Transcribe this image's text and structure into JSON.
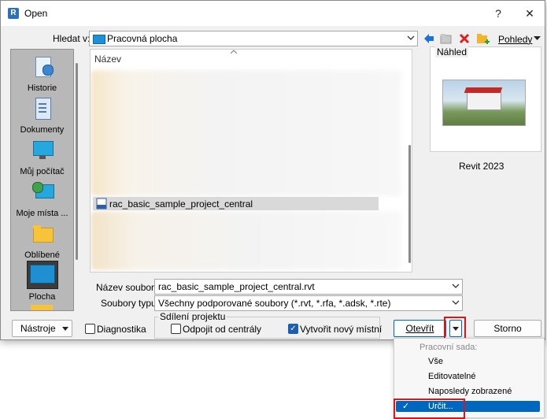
{
  "window": {
    "title": "Open",
    "app_icon": "R",
    "help": "?",
    "close": "✕"
  },
  "lookin": {
    "label": "Hledat v:",
    "value": "Pracovná plocha"
  },
  "toolbar": {
    "views_label": "Pohledy",
    "icons": [
      "back-arrow-icon",
      "up-folder-icon",
      "delete-icon",
      "new-folder-icon"
    ]
  },
  "places": [
    {
      "label": "Historie",
      "icon": "history-icon"
    },
    {
      "label": "Dokumenty",
      "icon": "documents-icon"
    },
    {
      "label": "Můj počítač",
      "icon": "computer-icon"
    },
    {
      "label": "Moje místa ...",
      "icon": "network-places-icon"
    },
    {
      "label": "Oblíbené",
      "icon": "favorites-folder-icon"
    },
    {
      "label": "Plocha",
      "icon": "desktop-icon"
    }
  ],
  "filelist": {
    "column_header": "Název",
    "selected_file": "rac_basic_sample_project_central"
  },
  "preview": {
    "label": "Náhled",
    "version": "Revit 2023"
  },
  "filename": {
    "label": "Název souboru:",
    "value": "rac_basic_sample_project_central.rvt"
  },
  "filetype": {
    "label": "Soubory typu:",
    "value": "Všechny podporované soubory  (*.rvt, *.rfa, *.adsk, *.rte)"
  },
  "sharing": {
    "group_label": "Sdílení projektu",
    "detach_label": "Odpojit od centrály",
    "create_local_label": "Vytvořit nový místní",
    "detach_checked": false,
    "create_local_checked": true
  },
  "bottom": {
    "tools_label": "Nástroje",
    "diagnostics_label": "Diagnostika",
    "open_label": "Otevřít",
    "cancel_label": "Storno"
  },
  "open_menu": {
    "header": "Pracovní sada:",
    "items": [
      "Vše",
      "Editovatelné",
      "Naposledy zobrazené",
      "Určit..."
    ],
    "checked_item": "Určit..."
  },
  "colors": {
    "accent": "#0067c0",
    "highlight_red": "#e01414",
    "places_bg": "#b8b8b8"
  }
}
